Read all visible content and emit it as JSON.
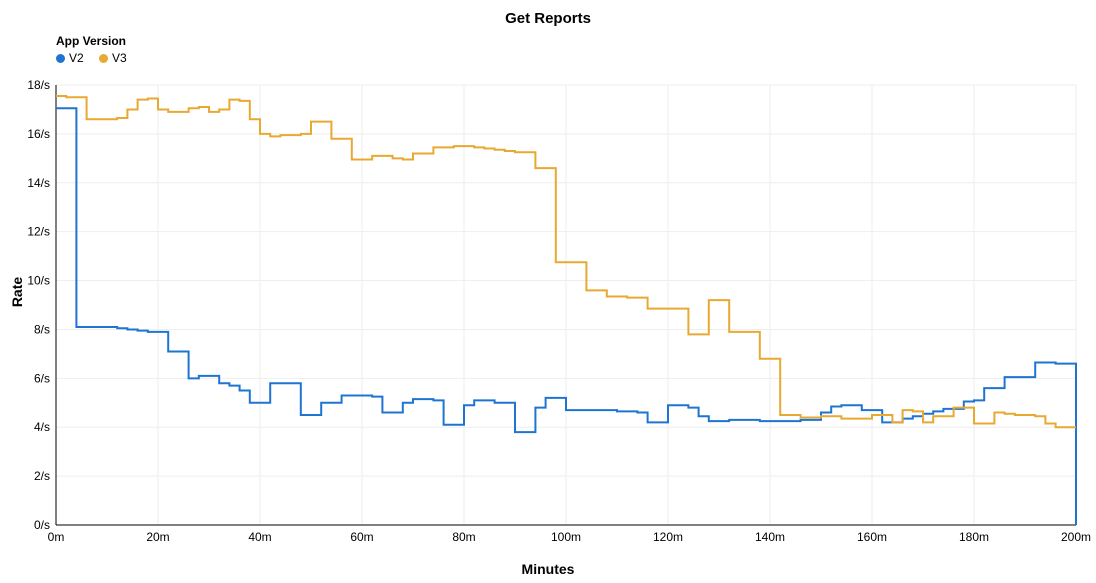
{
  "chart_data": {
    "type": "line",
    "title": "Get Reports",
    "xlabel": "Minutes",
    "ylabel": "Rate",
    "legend_title": "App Version",
    "x_ticks": [
      0,
      20,
      40,
      60,
      80,
      100,
      120,
      140,
      160,
      180,
      200
    ],
    "x_tick_suffix": "m",
    "y_ticks": [
      0,
      2,
      4,
      6,
      8,
      10,
      12,
      14,
      16,
      18
    ],
    "y_tick_suffix": "/s",
    "xlim": [
      0,
      200
    ],
    "ylim": [
      0,
      18
    ],
    "grid": true,
    "step_mode": "hv",
    "series": [
      {
        "name": "V2",
        "color": "#1e74d2",
        "x": [
          0,
          2,
          4,
          6,
          8,
          10,
          12,
          14,
          16,
          18,
          20,
          22,
          24,
          26,
          28,
          30,
          32,
          34,
          36,
          38,
          40,
          42,
          44,
          46,
          48,
          50,
          52,
          54,
          56,
          58,
          60,
          62,
          64,
          66,
          68,
          70,
          72,
          74,
          76,
          78,
          80,
          82,
          84,
          86,
          88,
          90,
          92,
          94,
          96,
          98,
          100,
          102,
          104,
          106,
          108,
          110,
          112,
          114,
          116,
          118,
          120,
          122,
          124,
          126,
          128,
          130,
          132,
          134,
          136,
          138,
          140,
          142,
          144,
          146,
          148,
          150,
          152,
          154,
          156,
          158,
          160,
          162,
          164,
          166,
          168,
          170,
          172,
          174,
          176,
          178,
          180,
          182,
          184,
          186,
          188,
          190,
          192,
          194,
          196,
          198,
          200
        ],
        "values": [
          17.05,
          17.05,
          8.1,
          8.1,
          8.1,
          8.1,
          8.05,
          8.0,
          7.95,
          7.9,
          7.9,
          7.1,
          7.1,
          6.0,
          6.1,
          6.1,
          5.8,
          5.7,
          5.5,
          5.0,
          5.0,
          5.8,
          5.8,
          5.8,
          4.5,
          4.5,
          5.0,
          5.0,
          5.3,
          5.3,
          5.3,
          5.25,
          4.6,
          4.6,
          5.0,
          5.15,
          5.15,
          5.1,
          4.1,
          4.1,
          4.9,
          5.1,
          5.1,
          5.0,
          5.0,
          3.8,
          3.8,
          4.8,
          5.2,
          5.2,
          4.7,
          4.7,
          4.7,
          4.7,
          4.7,
          4.65,
          4.65,
          4.6,
          4.2,
          4.2,
          4.9,
          4.9,
          4.8,
          4.45,
          4.25,
          4.25,
          4.3,
          4.3,
          4.3,
          4.25,
          4.25,
          4.25,
          4.25,
          4.3,
          4.3,
          4.6,
          4.85,
          4.9,
          4.9,
          4.7,
          4.7,
          4.2,
          4.2,
          4.35,
          4.45,
          4.55,
          4.65,
          4.75,
          4.75,
          5.05,
          5.1,
          5.6,
          5.6,
          6.05,
          6.05,
          6.05,
          6.65,
          6.65,
          6.6,
          6.6,
          0
        ]
      },
      {
        "name": "V3",
        "color": "#e8a932",
        "x": [
          0,
          2,
          4,
          6,
          8,
          10,
          12,
          14,
          16,
          18,
          20,
          22,
          24,
          26,
          28,
          30,
          32,
          34,
          36,
          38,
          40,
          42,
          44,
          46,
          48,
          50,
          52,
          54,
          56,
          58,
          60,
          62,
          64,
          66,
          68,
          70,
          72,
          74,
          76,
          78,
          80,
          82,
          84,
          86,
          88,
          90,
          92,
          94,
          96,
          98,
          100,
          102,
          104,
          106,
          108,
          110,
          112,
          114,
          116,
          118,
          120,
          122,
          124,
          126,
          128,
          130,
          132,
          134,
          136,
          138,
          140,
          142,
          144,
          146,
          148,
          150,
          152,
          154,
          156,
          158,
          160,
          162,
          164,
          166,
          168,
          170,
          172,
          174,
          176,
          178,
          180,
          182,
          184,
          186,
          188,
          190,
          192,
          194,
          196,
          198,
          200
        ],
        "values": [
          17.55,
          17.5,
          17.5,
          16.6,
          16.6,
          16.6,
          16.65,
          17.0,
          17.4,
          17.45,
          17.0,
          16.9,
          16.9,
          17.05,
          17.1,
          16.9,
          17.0,
          17.4,
          17.35,
          16.6,
          16.0,
          15.9,
          15.95,
          15.95,
          16.0,
          16.5,
          16.5,
          15.8,
          15.8,
          14.95,
          14.95,
          15.1,
          15.1,
          15.0,
          14.95,
          15.2,
          15.2,
          15.45,
          15.45,
          15.5,
          15.5,
          15.45,
          15.4,
          15.35,
          15.3,
          15.25,
          15.25,
          14.6,
          14.6,
          10.75,
          10.75,
          10.75,
          9.6,
          9.6,
          9.35,
          9.35,
          9.3,
          9.3,
          8.85,
          8.85,
          8.85,
          8.85,
          7.8,
          7.8,
          9.2,
          9.2,
          7.9,
          7.9,
          7.9,
          6.8,
          6.8,
          4.5,
          4.5,
          4.4,
          4.4,
          4.45,
          4.45,
          4.35,
          4.35,
          4.35,
          4.5,
          4.5,
          4.2,
          4.7,
          4.65,
          4.2,
          4.45,
          4.45,
          4.8,
          4.8,
          4.15,
          4.15,
          4.6,
          4.55,
          4.5,
          4.5,
          4.45,
          4.15,
          4.0,
          4.0,
          4.0
        ]
      }
    ]
  }
}
